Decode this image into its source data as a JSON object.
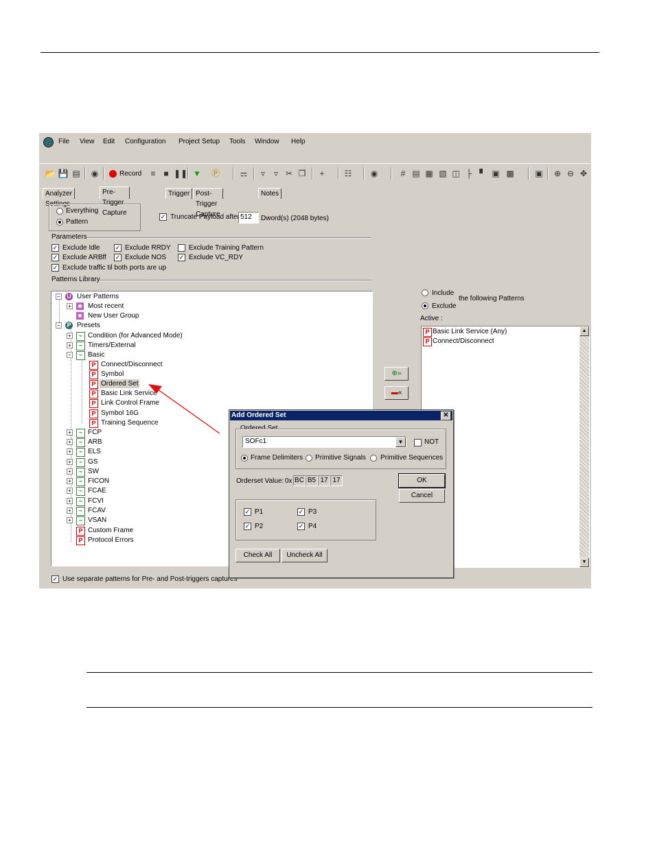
{
  "menu": [
    "File",
    "View",
    "Edit",
    "Configuration",
    "Project Setup",
    "Tools",
    "Window",
    "Help"
  ],
  "toolbar": {
    "record_label": "Record"
  },
  "tabs": [
    "Analyzer Settings",
    "Pre-Trigger Capture",
    "Trigger",
    "Post-Trigger Capture",
    "Notes"
  ],
  "capture_mode": {
    "everything": "Everything",
    "pattern": "Pattern",
    "selected": "Pattern"
  },
  "truncate": {
    "label": "Truncate Payload after",
    "value": "512",
    "suffix": "Dword(s) (2048 bytes)",
    "checked": true
  },
  "parameters": {
    "title": "Parameters",
    "items": [
      {
        "label": "Exclude Idle",
        "checked": true
      },
      {
        "label": "Exclude RRDY",
        "checked": true
      },
      {
        "label": "Exclude Training Pattern",
        "checked": false
      },
      {
        "label": "Exclude ARBff",
        "checked": true
      },
      {
        "label": "Exclude NOS",
        "checked": true
      },
      {
        "label": "Exclude VC_RDY",
        "checked": true
      },
      {
        "label": "Exclude traffic til both ports are up",
        "checked": true
      }
    ]
  },
  "library": {
    "title": "Patterns Library",
    "tree": [
      "User Patterns",
      "Most recent",
      "New User Group",
      "Presets",
      "Condition (for Advanced Mode)",
      "Timers/External",
      "Basic",
      "Connect/Disconnect",
      "Symbol",
      "Ordered Set",
      "Basic Link Service",
      "Link Control Frame",
      "Symbol 16G",
      "Training Sequence",
      "FCP",
      "ARB",
      "ELS",
      "GS",
      "SW",
      "FICON",
      "FCAE",
      "FCVI",
      "FCAV",
      "VSAN",
      "Custom Frame",
      "Protocol Errors"
    ]
  },
  "filter": {
    "include": "Include",
    "exclude": "Exclude",
    "selected": "Exclude",
    "suffix": "the following Patterns",
    "active_label": "Active :"
  },
  "active_list": [
    "Basic Link Service (Any)",
    "Connect/Disconnect"
  ],
  "separate_patterns": {
    "label": "Use separate patterns for Pre- and Post-triggers captures",
    "checked": true
  },
  "dialog": {
    "title": "Add Ordered Set",
    "group_label": "Ordered Set",
    "combo_value": "SOFc1",
    "not_label": "NOT",
    "radios": [
      "Frame Delimiters",
      "Primitive Signals",
      "Primitive Sequences"
    ],
    "selected_radio": "Frame Delimiters",
    "value_label": "Orderset Value:",
    "value_prefix": "0x",
    "hex": [
      "BC",
      "B5",
      "17",
      "17"
    ],
    "ok": "OK",
    "cancel": "Cancel",
    "checks": [
      {
        "label": "P1",
        "checked": true
      },
      {
        "label": "P3",
        "checked": true
      },
      {
        "label": "P2",
        "checked": true
      },
      {
        "label": "P4",
        "checked": true
      }
    ],
    "check_all": "Check All",
    "uncheck_all": "Uncheck All"
  }
}
